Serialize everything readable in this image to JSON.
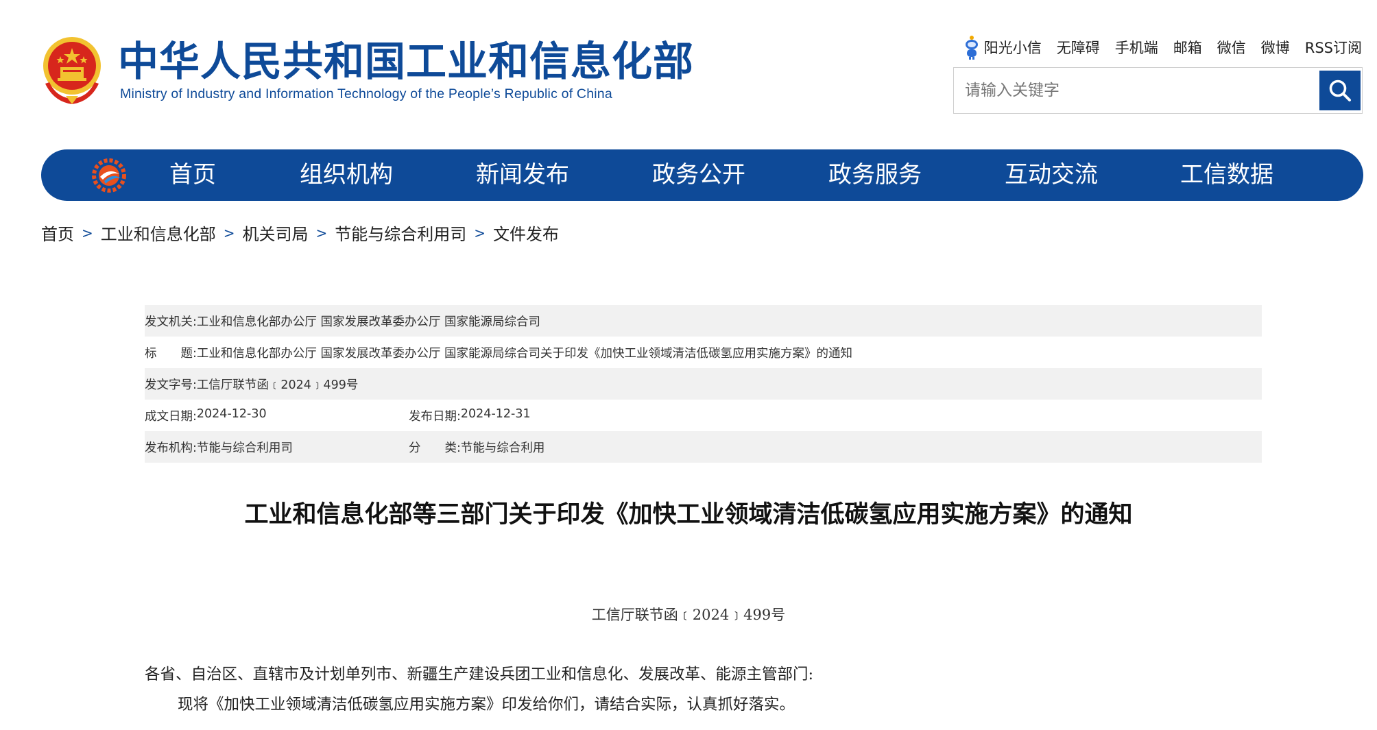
{
  "header": {
    "site_title": "中华人民共和国工业和信息化部",
    "site_subtitle": "Ministry of Industry and Information Technology of the People’s Republic of China",
    "top_links": [
      "阳光小信",
      "无障碍",
      "手机端",
      "邮箱",
      "微信",
      "微博",
      "RSS订阅"
    ],
    "search_placeholder": "请输入关键字",
    "colors": {
      "brand": "#0e4a98",
      "emblem_red": "#d7261c",
      "emblem_gold": "#f2c230"
    }
  },
  "nav": {
    "items": [
      "首页",
      "组织机构",
      "新闻发布",
      "政务公开",
      "政务服务",
      "互动交流",
      "工信数据"
    ]
  },
  "breadcrumb": [
    "首页",
    "工业和信息化部",
    "机关司局",
    "节能与综合利用司",
    "文件发布"
  ],
  "breadcrumb_separator": ">",
  "meta": {
    "issuer_label": "发文机关:",
    "issuer": "工业和信息化部办公厅 国家发展改革委办公厅 国家能源局综合司",
    "title_label": "标　　题:",
    "title": "工业和信息化部办公厅 国家发展改革委办公厅 国家能源局综合司关于印发《加快工业领域清洁低碳氢应用实施方案》的通知",
    "doc_no_label": "发文字号:",
    "doc_no": "工信厅联节函﹝2024﹞499号",
    "created_label": "成文日期:",
    "created": "2024-12-30",
    "published_label": "发布日期:",
    "published": "2024-12-31",
    "org_label": "发布机构:",
    "org": "节能与综合利用司",
    "category_label": "分　　类:",
    "category": "节能与综合利用"
  },
  "article": {
    "title": "工业和信息化部等三部门关于印发《加快工业领域清洁低碳氢应用实施方案》的通知",
    "doc_number": "工信厅联节函﹝2024﹞499号",
    "addressee": "各省、自治区、直辖市及计划单列市、新疆生产建设兵团工业和信息化、发展改革、能源主管部门:",
    "body_line1": "现将《加快工业领域清洁低碳氢应用实施方案》印发给你们，请结合实际，认真抓好落实。"
  }
}
